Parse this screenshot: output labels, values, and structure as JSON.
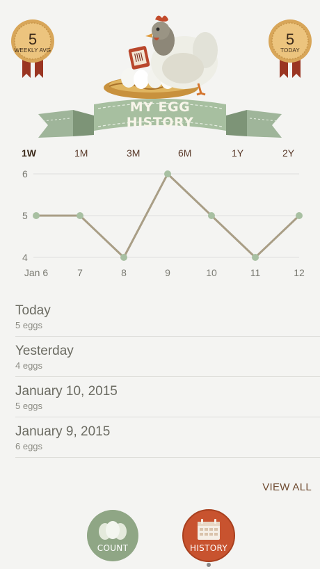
{
  "badges": {
    "weekly": {
      "value": "5",
      "label": "WEEKLY AVG"
    },
    "today": {
      "value": "5",
      "label": "TODAY"
    }
  },
  "header": {
    "title": "MY EGG HISTORY"
  },
  "ranges": [
    "1W",
    "1M",
    "3M",
    "6M",
    "1Y",
    "2Y"
  ],
  "selected_range": "1W",
  "chart_data": {
    "type": "line",
    "categories": [
      "Jan 6",
      "7",
      "8",
      "9",
      "10",
      "11",
      "12"
    ],
    "series": [
      {
        "values": [
          5,
          5,
          4,
          6,
          5,
          4,
          5
        ]
      }
    ],
    "ylim": [
      4,
      6
    ],
    "yticks": [
      "4",
      "5",
      "6"
    ],
    "grid": true
  },
  "history": [
    {
      "title": "Today",
      "count": "5 eggs"
    },
    {
      "title": "Yesterday",
      "count": "4 eggs"
    },
    {
      "title": "January 10, 2015",
      "count": "5 eggs"
    },
    {
      "title": "January 9, 2015",
      "count": "6 eggs"
    }
  ],
  "view_all_label": "VIEW ALL",
  "nav": {
    "count_label": "COUNT",
    "history_label": "HISTORY"
  },
  "colors": {
    "line": "#a99e86",
    "point": "#a8c0a2",
    "badge": "#e7c07a",
    "ribbon": "#8e2f1f",
    "banner": "#a7bfa0",
    "count_button": "#8fa685",
    "history_button": "#c8532f"
  }
}
